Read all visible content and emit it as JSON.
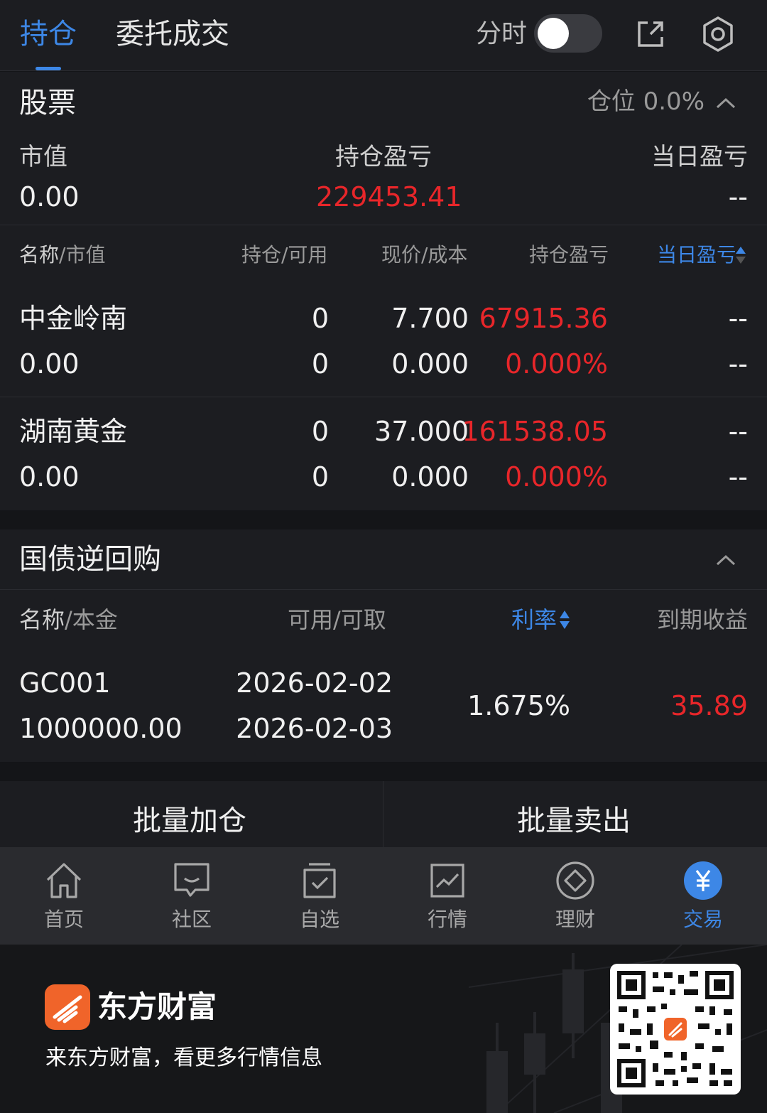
{
  "top_tabs": {
    "active": "持仓",
    "inactive": "委托成交"
  },
  "fenshi_label": "分时",
  "icons": {
    "share": "share-external-icon",
    "settings": "gear-icon"
  },
  "stock": {
    "title": "股票",
    "position_label": "仓位 0.0%",
    "summary": {
      "market_value_label": "市值",
      "market_value": "0.00",
      "holding_pl_label": "持仓盈亏",
      "holding_pl": "229453.41",
      "daily_pl_label": "当日盈亏",
      "daily_pl": "--"
    },
    "headers": {
      "name_primary": "名称",
      "name_secondary": "/市值",
      "hold": "持仓/可用",
      "price": "现价/成本",
      "pl": "持仓盈亏",
      "daily": "当日盈亏"
    },
    "rows": [
      {
        "name": "中金岭南",
        "market_value": "0.00",
        "hold": "0",
        "available": "0",
        "price": "7.700",
        "cost": "0.000",
        "pl": "67915.36",
        "pl_pct": "0.000%",
        "daily1": "--",
        "daily2": "--"
      },
      {
        "name": "湖南黄金",
        "market_value": "0.00",
        "hold": "0",
        "available": "0",
        "price": "37.000",
        "cost": "0.000",
        "pl": "161538.05",
        "pl_pct": "0.000%",
        "daily1": "--",
        "daily2": "--"
      }
    ]
  },
  "repo": {
    "title": "国债逆回购",
    "headers": {
      "name_primary": "名称",
      "name_secondary": "/本金",
      "avail": "可用/可取",
      "rate": "利率",
      "income": "到期收益"
    },
    "row": {
      "code": "GC001",
      "principal": "1000000.00",
      "date1": "2026-02-02",
      "date2": "2026-02-03",
      "rate": "1.675%",
      "income": "35.89"
    }
  },
  "actions": {
    "batch_add": "批量加仓",
    "batch_sell": "批量卖出"
  },
  "nav": [
    {
      "label": "首页",
      "icon": "home-icon"
    },
    {
      "label": "社区",
      "icon": "chat-icon"
    },
    {
      "label": "自选",
      "icon": "watchlist-icon"
    },
    {
      "label": "行情",
      "icon": "chart-icon"
    },
    {
      "label": "理财",
      "icon": "wealth-icon"
    },
    {
      "label": "交易",
      "icon": "yuan-icon"
    }
  ],
  "banner": {
    "brand": "东方财富",
    "slogan": "来东方财富，看更多行情信息"
  },
  "colors": {
    "accent": "#3d87e6",
    "up": "#e8262a",
    "background": "#141518",
    "panel": "#1c1d21"
  }
}
